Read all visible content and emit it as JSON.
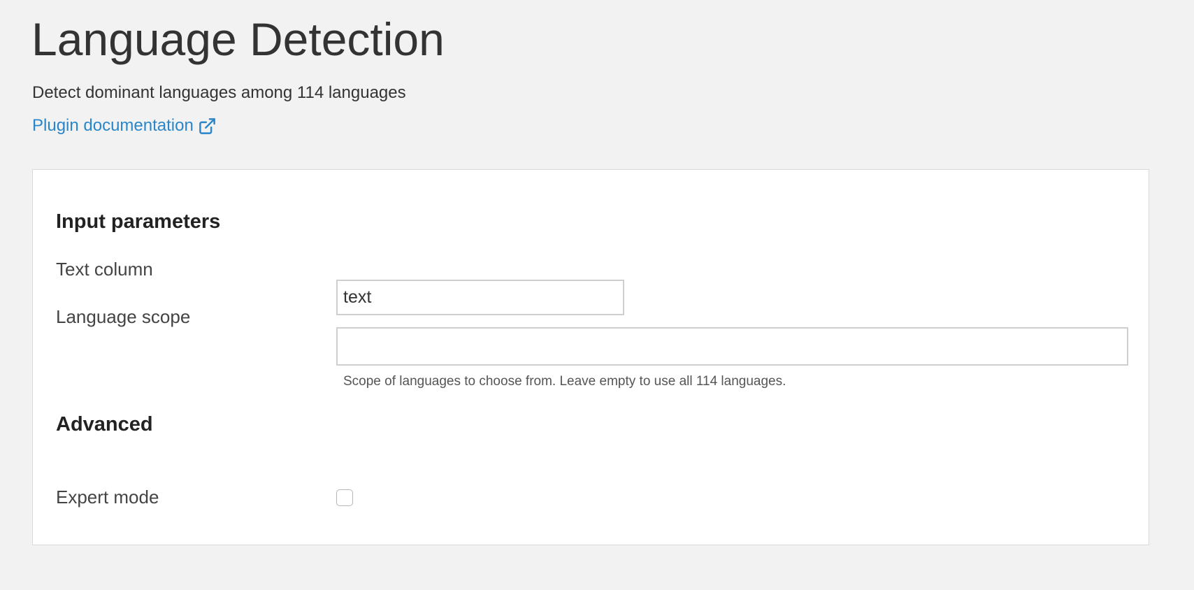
{
  "header": {
    "title": "Language Detection",
    "description": "Detect dominant languages among 114 languages",
    "doc_link_label": "Plugin documentation",
    "doc_link_icon": "external-link-icon",
    "link_color": "#2a86c8"
  },
  "form": {
    "input_section_title": "Input parameters",
    "text_column": {
      "label": "Text column",
      "value": "text"
    },
    "language_scope": {
      "label": "Language scope",
      "value": "",
      "help": "Scope of languages to choose from. Leave empty to use all 114 languages."
    },
    "advanced_section_title": "Advanced",
    "expert_mode": {
      "label": "Expert mode",
      "checked": false
    }
  }
}
